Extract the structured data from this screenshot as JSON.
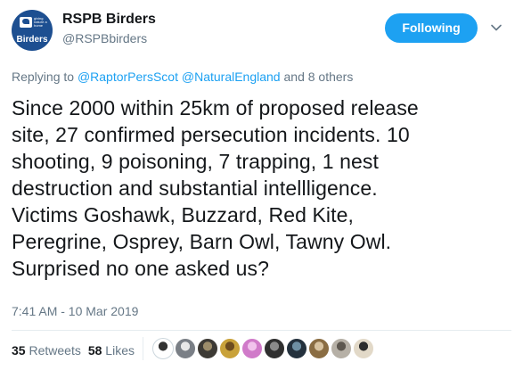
{
  "author": {
    "display_name": "RSPB Birders",
    "handle": "@RSPBbirders",
    "avatar": {
      "brand": "Birders",
      "tagline": "giving nature a home"
    }
  },
  "follow_button": {
    "label": "Following"
  },
  "reply": {
    "prefix": "Replying to",
    "mentions": [
      "@RaptorPersScot",
      "@NaturalEngland"
    ],
    "suffix": "and 8 others"
  },
  "tweet_lines": [
    "Since 2000 within 25km of proposed release",
    "site, 27 confirmed persecution incidents. 10",
    "shooting, 9 poisoning, 7 trapping, 1 nest",
    "destruction and substantial intellligence.",
    "Victims Goshawk, Buzzard, Red Kite,",
    "Peregrine, Osprey, Barn Owl, Tawny Owl.",
    "Surprised no one asked us?"
  ],
  "timestamp": "7:41 AM - 10 Mar 2019",
  "stats": {
    "retweets_count": "35",
    "retweets_label": "Retweets",
    "likes_count": "58",
    "likes_label": "Likes"
  },
  "likers": [
    {
      "icon": "liker-avatar-1",
      "color": "#ffffff",
      "accent": "#333333"
    },
    {
      "icon": "liker-avatar-2",
      "color": "#7a7f86",
      "accent": "#e8e8e8"
    },
    {
      "icon": "liker-avatar-3",
      "color": "#3d3a35",
      "accent": "#9c8c6a"
    },
    {
      "icon": "liker-avatar-4",
      "color": "#c9a23a",
      "accent": "#6d4c1e"
    },
    {
      "icon": "liker-avatar-5",
      "color": "#d07ac9",
      "accent": "#f1c2ec"
    },
    {
      "icon": "liker-avatar-6",
      "color": "#2f2f2f",
      "accent": "#8a8a8a"
    },
    {
      "icon": "liker-avatar-7",
      "color": "#24313d",
      "accent": "#6e8fa3"
    },
    {
      "icon": "liker-avatar-8",
      "color": "#8a6d43",
      "accent": "#d8c3a0"
    },
    {
      "icon": "liker-avatar-9",
      "color": "#b6b0a6",
      "accent": "#5d574f"
    },
    {
      "icon": "liker-avatar-10",
      "color": "#e2d9c8",
      "accent": "#2b2b2b"
    }
  ]
}
